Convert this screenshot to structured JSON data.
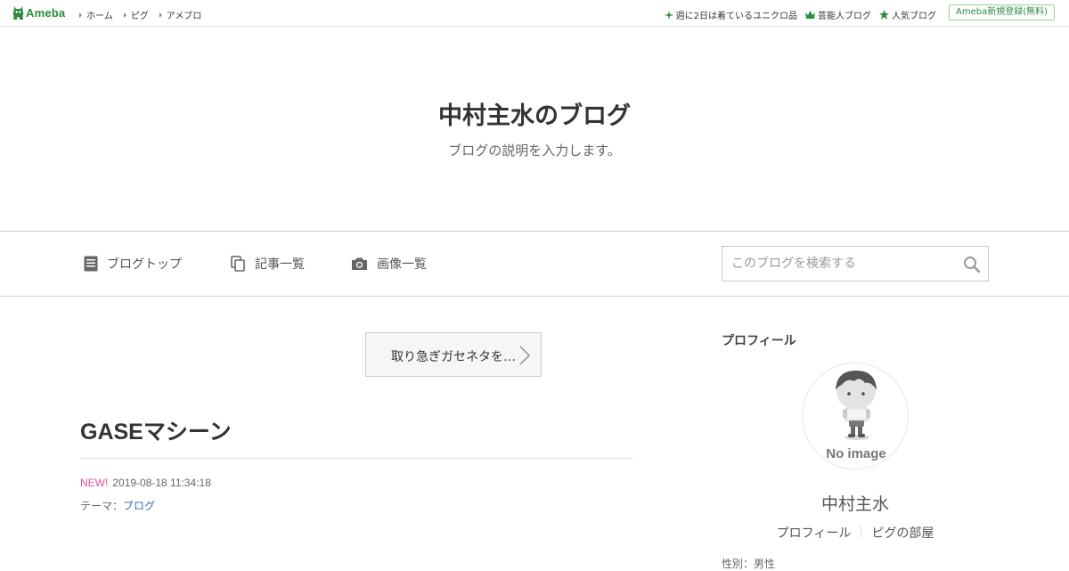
{
  "header": {
    "logo_text": "Ameba",
    "nav": [
      "ホーム",
      "ピグ",
      "アメブロ"
    ],
    "promos": [
      {
        "label": "週に2日は着ているユニクロ品",
        "icon": "sparkle-icon"
      },
      {
        "label": "芸能人ブログ",
        "icon": "crown-icon"
      },
      {
        "label": "人気ブログ",
        "icon": "star-icon"
      }
    ],
    "signup_label": "Ameba新規登録(無料)",
    "accent": "#2d8c3c"
  },
  "blog": {
    "title": "中村主水のブログ",
    "description": "ブログの説明を入力します。"
  },
  "blog_nav": {
    "items": [
      {
        "label": "ブログトップ",
        "icon": "document-icon"
      },
      {
        "label": "記事一覧",
        "icon": "copy-icon"
      },
      {
        "label": "画像一覧",
        "icon": "camera-icon"
      }
    ],
    "search_placeholder": "このブログを検索する"
  },
  "main": {
    "next_entry_label": "取り急ぎガセネタを…",
    "entry": {
      "title": "GASEマシーン",
      "new_badge": "NEW!",
      "date": "2019-08-18 11:34:18",
      "theme_label": "テーマ：",
      "theme_value": "ブログ"
    }
  },
  "sidebar": {
    "heading": "プロフィール",
    "avatar_text": "No image",
    "name": "中村主水",
    "links": [
      "プロフィール",
      "ピグの部屋"
    ],
    "cut_text": "性別：男性"
  }
}
